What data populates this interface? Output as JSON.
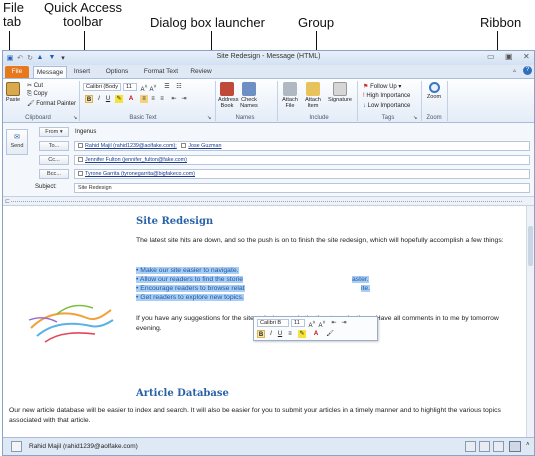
{
  "callouts": {
    "file_tab": "File tab",
    "qat": "Quick Access toolbar",
    "dialog_launcher": "Dialog box launcher",
    "group": "Group",
    "ribbon": "Ribbon"
  },
  "window": {
    "title": "Site Redesign - Message (HTML)"
  },
  "tabs": [
    "File",
    "Message",
    "Insert",
    "Options",
    "Format Text",
    "Review"
  ],
  "ribbon": {
    "clipboard": {
      "paste": "Paste",
      "cut": "Cut",
      "copy": "Copy",
      "format_painter": "Format Painter",
      "label": "Clipboard"
    },
    "basic_text": {
      "font": "Calibri (Body",
      "size": "11",
      "label": "Basic Text"
    },
    "names": {
      "address_book": "Address Book",
      "check_names": "Check Names",
      "label": "Names"
    },
    "include": {
      "attach_file": "Attach File",
      "attach_item": "Attach Item",
      "signature": "Signature",
      "label": "Include"
    },
    "tags": {
      "follow_up": "Follow Up",
      "high": "High Importance",
      "low": "Low Importance",
      "label": "Tags"
    },
    "zoom": {
      "zoom": "Zoom",
      "label": "Zoom"
    }
  },
  "header": {
    "send": "Send",
    "from_btn": "From",
    "from_value": "Ingenus",
    "to_btn": "To...",
    "to_values": [
      "Rahid Majil (rahid1239@aolfake.com);",
      "Jose Guzman"
    ],
    "cc_btn": "Cc...",
    "cc_value": "Jennifer Fulton (jennifer_fulton@fake.com)",
    "bcc_btn": "Bcc...",
    "bcc_value": "Tyrone Garrita (tyronegarrita@bigfakeco.com)",
    "subject_label": "Subject:",
    "subject_value": "Site Redesign"
  },
  "body": {
    "heading1": "Site Redesign",
    "para1": "The latest site hits are down, and so the push is on to finish the site redesign, which will hopefully accomplish a few things:",
    "bullets": [
      "Make our site easier to navigate.",
      "Allow our readers to find the storie",
      "Encourage readers to browse relat",
      "Get readers to explore new topics."
    ],
    "bullet_tails": [
      "",
      "aster.",
      "ite.",
      ""
    ],
    "para2": "If you have any suggestions for the site redesign, now's the time to make them. Have all comments in to me by tomorrow evening.",
    "heading2": "Article Database",
    "para3": "Our new article database will be easier to index and search. It will also be easier for you to submit your articles in a timely manner and to highlight the various topics associated with that article."
  },
  "minitoolbar": {
    "font": "Calibri B",
    "size": "11"
  },
  "status": {
    "person": "Rahid Majil (rahid1239@aolfake.com)"
  }
}
